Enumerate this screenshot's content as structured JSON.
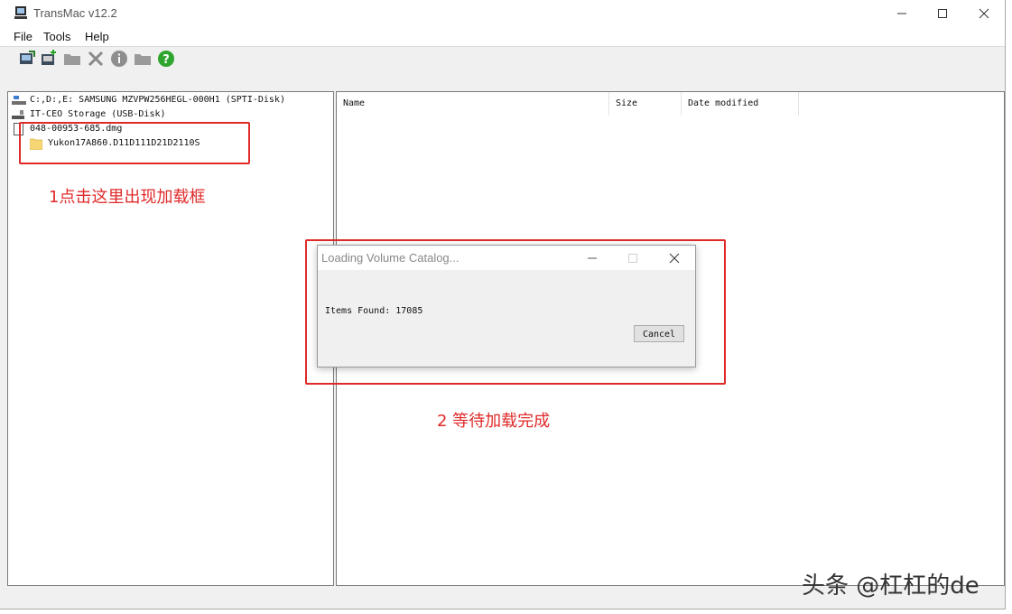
{
  "window": {
    "title": "TransMac v12.2"
  },
  "menu": {
    "file": "File",
    "tools": "Tools",
    "help": "Help"
  },
  "toolbar": {
    "icons": [
      "open-disk-icon",
      "add-disk-icon",
      "folder-icon",
      "delete-icon",
      "info-icon",
      "new-folder-icon",
      "help-icon"
    ]
  },
  "tree": {
    "items": [
      {
        "label": "C:,D:,E:  SAMSUNG MZVPW256HEGL-000H1 (SPTI-Disk)",
        "icon": "hard-drive-icon"
      },
      {
        "label": "IT-CEO Storage (USB-Disk)",
        "icon": "usb-drive-icon"
      },
      {
        "label": "048-00953-685.dmg",
        "icon": "file-icon"
      },
      {
        "label": "Yukon17A860.D11D111D21D2110S",
        "icon": "folder-icon"
      }
    ]
  },
  "list": {
    "columns": [
      "Name",
      "Size",
      "Date modified"
    ]
  },
  "annotations": {
    "step1": "1点击这里出现加载框",
    "step2": "2 等待加载完成",
    "color": "#e02a2a"
  },
  "dialog": {
    "title": "Loading Volume Catalog...",
    "message": "Items Found: 17085",
    "cancel": "Cancel"
  },
  "watermark": "头条 @杠杠的de"
}
